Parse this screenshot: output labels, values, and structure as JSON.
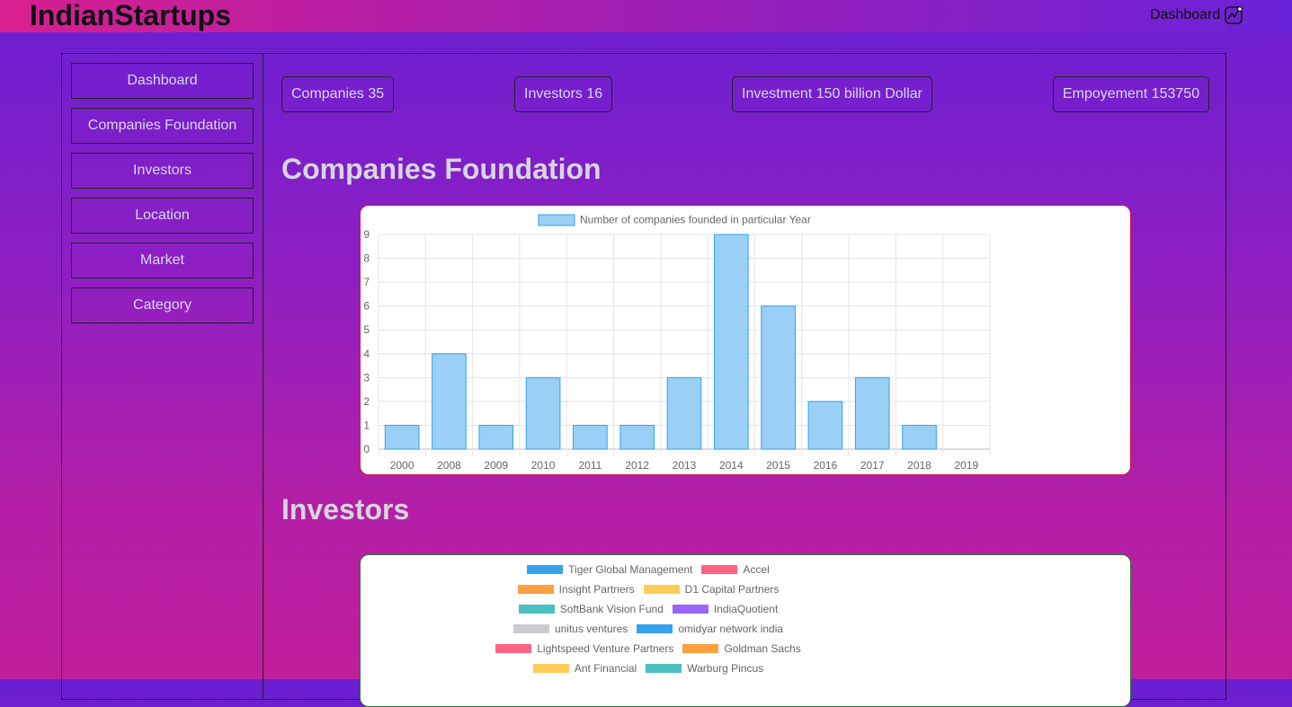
{
  "header": {
    "brand": "IndianStartups",
    "nav_label": "Dashboard",
    "nav_icon": "chart-icon"
  },
  "sidebar": {
    "items": [
      {
        "label": "Dashboard"
      },
      {
        "label": "Companies Foundation"
      },
      {
        "label": "Investors"
      },
      {
        "label": "Location"
      },
      {
        "label": "Market"
      },
      {
        "label": "Category"
      }
    ]
  },
  "stats": [
    {
      "label": "Companies 35"
    },
    {
      "label": "Investors 16"
    },
    {
      "label": "Investment 150 billion Dollar"
    },
    {
      "label": "Empoyement 153750"
    }
  ],
  "sections": {
    "companies_title": "Companies Foundation",
    "investors_title": "Investors"
  },
  "colors": {
    "bar_fill": "#9ad0f5",
    "bar_border": "#36a2eb",
    "card1_border": "#e0103a",
    "card2_border": "#2a7a2a"
  },
  "chart_data": [
    {
      "type": "bar",
      "legend": "Number of companies founded in particular Year",
      "categories": [
        "2000",
        "2008",
        "2009",
        "2010",
        "2011",
        "2012",
        "2013",
        "2014",
        "2015",
        "2016",
        "2017",
        "2018",
        "2019"
      ],
      "values": [
        1,
        4,
        1,
        3,
        1,
        1,
        3,
        9,
        6,
        2,
        3,
        1,
        0
      ],
      "ylim": [
        0,
        9
      ],
      "yticks": [
        "0",
        "1",
        "2",
        "3",
        "4",
        "5",
        "6",
        "7",
        "8",
        "9"
      ],
      "grid": true,
      "legend_position": "top"
    },
    {
      "type": "pie",
      "legend_position": "top",
      "legend_items": [
        {
          "name": "Tiger Global Management",
          "color": "#36a2eb"
        },
        {
          "name": "Accel",
          "color": "#ff6384"
        },
        {
          "name": "Insight Partners",
          "color": "#ff9f40"
        },
        {
          "name": "D1 Capital Partners",
          "color": "#ffcd56"
        },
        {
          "name": "SoftBank Vision Fund",
          "color": "#4bc0c0"
        },
        {
          "name": "IndiaQuotient",
          "color": "#9966ff"
        },
        {
          "name": "unitus ventures",
          "color": "#c9cbcf"
        },
        {
          "name": "omidyar network india",
          "color": "#36a2eb"
        },
        {
          "name": "Lightspeed Venture Partners",
          "color": "#ff6384"
        },
        {
          "name": "Goldman Sachs",
          "color": "#ff9f40"
        },
        {
          "name": "Ant Financial",
          "color": "#ffcd56"
        },
        {
          "name": "Warburg Pincus",
          "color": "#4bc0c0"
        }
      ]
    }
  ]
}
